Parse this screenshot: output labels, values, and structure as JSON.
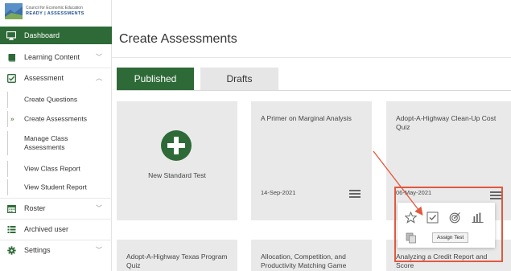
{
  "logo": {
    "line1": "Council for Economic Education",
    "line2": "READY | ASSESSMENTS"
  },
  "sidebar": {
    "items": [
      {
        "label": "Dashboard",
        "icon": "monitor-icon",
        "active": true
      },
      {
        "label": "Learning Content",
        "icon": "book-icon",
        "chevron": "﹀"
      },
      {
        "label": "Assessment",
        "icon": "checkbox-icon",
        "chevron": "︿"
      },
      {
        "label": "Roster",
        "icon": "calendar-icon",
        "chevron": "﹀"
      },
      {
        "label": "Archived user",
        "icon": "list-icon"
      },
      {
        "label": "Settings",
        "icon": "gear-icon",
        "chevron": "﹀"
      }
    ],
    "sub_items": [
      {
        "label": "Create Questions"
      },
      {
        "label": "Create Assessments",
        "marker": "»"
      },
      {
        "label": "Manage Class Assessments"
      },
      {
        "label": "View Class Report"
      },
      {
        "label": "View Student Report"
      }
    ]
  },
  "main": {
    "title": "Create Assessments",
    "tabs": [
      {
        "label": "Published"
      },
      {
        "label": "Drafts"
      }
    ],
    "new_test_label": "New Standard Test",
    "cards": [
      {
        "title": "A Primer on Marginal Analysis",
        "date": "14-Sep-2021"
      },
      {
        "title": "Adopt-A-Highway Clean-Up Cost Quiz",
        "date": "06-May-2021"
      },
      {
        "title": "Adopt-A-Highway Texas Program Quiz"
      },
      {
        "title": "Allocation, Competition, and Productivity Matching Game"
      },
      {
        "title": "Analyzing a Credit Report and Score"
      }
    ],
    "action_menu": {
      "icons": [
        "star-icon",
        "checkbox-icon",
        "target-icon",
        "bar-chart-icon",
        "copy-icon"
      ],
      "tooltip": "Assign Test"
    }
  },
  "colors": {
    "brand_green": "#2e6a37",
    "card_gray": "#e9e9e9",
    "annotation_red": "#e2583e"
  }
}
